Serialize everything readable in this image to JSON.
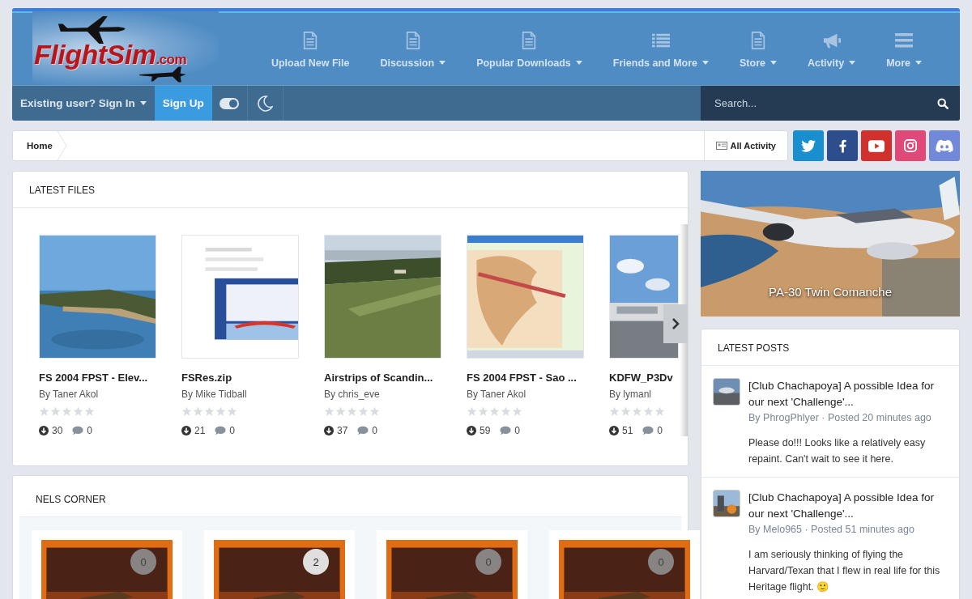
{
  "logo": {
    "name": "FlightSim",
    "suffix": ".com"
  },
  "nav": [
    {
      "label": "Upload New File",
      "kind": "document",
      "dropdown": false
    },
    {
      "label": "Discussion",
      "kind": "document",
      "dropdown": true
    },
    {
      "label": "Popular Downloads",
      "kind": "document",
      "dropdown": true
    },
    {
      "label": "Friends and More",
      "kind": "list",
      "dropdown": true
    },
    {
      "label": "Store",
      "kind": "document",
      "dropdown": true
    },
    {
      "label": "Activity",
      "kind": "megaphone",
      "dropdown": true
    },
    {
      "label": "More",
      "kind": "menu",
      "dropdown": true
    }
  ],
  "user_bar": {
    "sign_in": "Existing user? Sign In",
    "sign_up": "Sign Up",
    "search": {
      "placeholder": "Search..."
    }
  },
  "breadcrumb": [
    {
      "label": "Home"
    }
  ],
  "all_activity": "All Activity",
  "social": [
    {
      "kind": "twitter",
      "color": "#1a8fd0"
    },
    {
      "kind": "facebook",
      "color": "#2e4d8c"
    },
    {
      "kind": "youtube",
      "color": "#d0312d"
    },
    {
      "kind": "instagram",
      "color": "#e04a78"
    },
    {
      "kind": "discord",
      "color": "#7289da"
    }
  ],
  "latest_files": {
    "title": "LATEST FILES",
    "items": [
      {
        "title": "FS 2004 FPST - Elev...",
        "author": "By Taner Akol",
        "stars": 0,
        "downloads": "30",
        "comments": "0"
      },
      {
        "title": "FSRes.zip",
        "author": "By Mike Tidball",
        "stars": 0,
        "downloads": "21",
        "comments": "0"
      },
      {
        "title": "Airstrips of Scandin...",
        "author": "By chris_eve",
        "stars": 0,
        "downloads": "37",
        "comments": "0"
      },
      {
        "title": "FS 2004 FPST - Sao ...",
        "author": "By Taner Akol",
        "stars": 0,
        "downloads": "59",
        "comments": "0"
      },
      {
        "title": "KDFW_P3Dv",
        "author": "By lymanl",
        "stars": 0,
        "downloads": "51",
        "comments": "0"
      }
    ]
  },
  "nels_corner": {
    "title": "NELS CORNER",
    "items": [
      {
        "comments": "0",
        "unread": false
      },
      {
        "comments": "2",
        "unread": true
      },
      {
        "comments": "0",
        "unread": false
      },
      {
        "comments": "0",
        "unread": false
      }
    ]
  },
  "promo": {
    "caption": "PA-30 Twin Comanche"
  },
  "latest_posts": {
    "title": "LATEST POSTS",
    "items": [
      {
        "title": "[Club Chachapoya] A possible Idea for our next 'Challenge'...",
        "meta": "By PhrogPhlyer · Posted 20 minutes ago",
        "excerpt": "Please do!!! Looks like a relatively easy repaint. Can't wait to see it here."
      },
      {
        "title": "[Club Chachapoya] A possible Idea for our next 'Challenge'...",
        "meta": "By Melo965 · Posted 51 minutes ago",
        "excerpt": "I am seriously thinking of flying the Harvard/Texan that I flew in real life for this Heritage flight. 🙂"
      }
    ]
  }
}
